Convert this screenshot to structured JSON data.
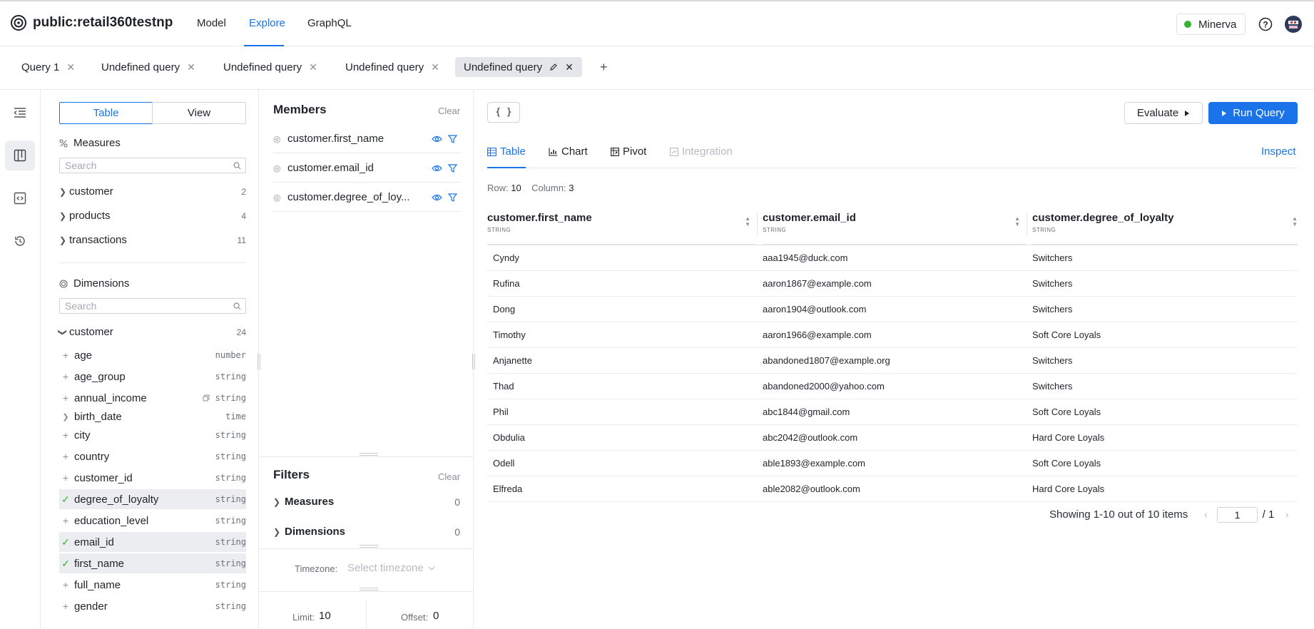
{
  "app": {
    "title": "public:retail360testnp",
    "nav": [
      "Model",
      "Explore",
      "GraphQL"
    ],
    "env": "Minerva",
    "colors": {
      "accent": "#1a73e8",
      "status_ok": "#34b233"
    }
  },
  "query_tabs": [
    "Query 1",
    "Undefined query",
    "Undefined query",
    "Undefined query",
    "Undefined query"
  ],
  "schema": {
    "toggle": [
      "Table",
      "View"
    ],
    "measures_title": "Measures",
    "search_placeholder": "Search",
    "measure_groups": [
      {
        "name": "customer",
        "count": "2"
      },
      {
        "name": "products",
        "count": "4"
      },
      {
        "name": "transactions",
        "count": "11"
      }
    ],
    "dimensions_title": "Dimensions",
    "dimension_group": {
      "name": "customer",
      "count": "24"
    },
    "fields": [
      {
        "name": "age",
        "type": "number"
      },
      {
        "name": "age_group",
        "type": "string"
      },
      {
        "name": "annual_income",
        "type": "string"
      },
      {
        "name": "birth_date",
        "type": "time"
      },
      {
        "name": "city",
        "type": "string"
      },
      {
        "name": "country",
        "type": "string"
      },
      {
        "name": "customer_id",
        "type": "string"
      },
      {
        "name": "degree_of_loyalty",
        "type": "string",
        "selected": true
      },
      {
        "name": "education_level",
        "type": "string"
      },
      {
        "name": "email_id",
        "type": "string",
        "selected": true
      },
      {
        "name": "first_name",
        "type": "string",
        "selected": true
      },
      {
        "name": "full_name",
        "type": "string"
      },
      {
        "name": "gender",
        "type": "string"
      }
    ]
  },
  "members": {
    "title": "Members",
    "clear": "Clear",
    "items": [
      "customer.first_name",
      "customer.email_id",
      "customer.degree_of_loy..."
    ]
  },
  "filters": {
    "title": "Filters",
    "clear": "Clear",
    "measures_label": "Measures",
    "measures_count": "0",
    "dimensions_label": "Dimensions",
    "dimensions_count": "0",
    "timezone_label": "Timezone:",
    "timezone_placeholder": "Select timezone",
    "limit_label": "Limit:",
    "limit_value": "10",
    "offset_label": "Offset:",
    "offset_value": "0"
  },
  "toolbar": {
    "json_label": "{ }",
    "evaluate_label": "Evaluate",
    "run_label": "Run Query"
  },
  "result_tabs": [
    "Table",
    "Chart",
    "Pivot",
    "Integration"
  ],
  "inspect_label": "Inspect",
  "summary": {
    "row_label": "Row:",
    "row_value": "10",
    "column_label": "Column:",
    "column_value": "3"
  },
  "table": {
    "columns": [
      {
        "name": "customer.first_name",
        "type": "STRING"
      },
      {
        "name": "customer.email_id",
        "type": "STRING"
      },
      {
        "name": "customer.degree_of_loyalty",
        "type": "STRING"
      }
    ],
    "rows": [
      [
        "Cyndy",
        "aaa1945@duck.com",
        "Switchers"
      ],
      [
        "Rufina",
        "aaron1867@example.com",
        "Switchers"
      ],
      [
        "Dong",
        "aaron1904@outlook.com",
        "Switchers"
      ],
      [
        "Timothy",
        "aaron1966@example.com",
        "Soft Core Loyals"
      ],
      [
        "Anjanette",
        "abandoned1807@example.org",
        "Switchers"
      ],
      [
        "Thad",
        "abandoned2000@yahoo.com",
        "Switchers"
      ],
      [
        "Phil",
        "abc1844@gmail.com",
        "Soft Core Loyals"
      ],
      [
        "Obdulia",
        "abc2042@outlook.com",
        "Hard Core Loyals"
      ],
      [
        "Odell",
        "able1893@example.com",
        "Soft Core Loyals"
      ],
      [
        "Elfreda",
        "able2082@outlook.com",
        "Hard Core Loyals"
      ]
    ]
  },
  "pagination": {
    "text": "Showing 1-10 out of 10 items",
    "page": "1",
    "total": "/ 1"
  }
}
